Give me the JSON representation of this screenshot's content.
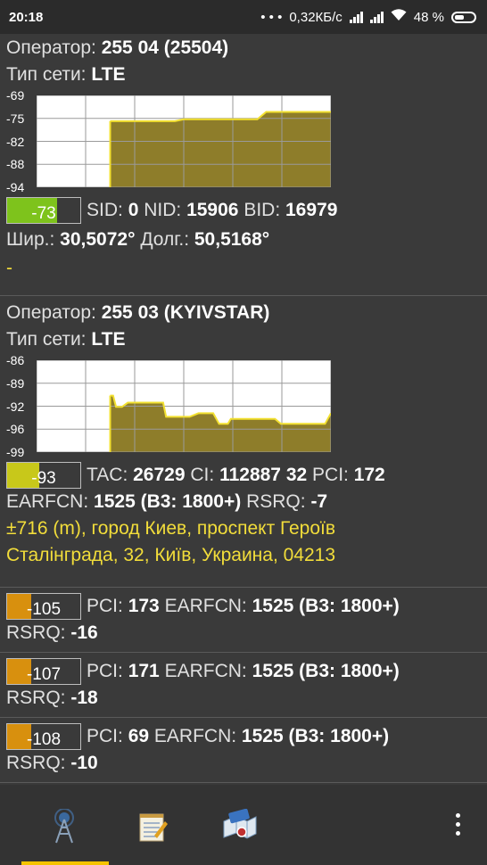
{
  "status_bar": {
    "time": "20:18",
    "dots": "• • •",
    "net_speed": "0,32КБ/с",
    "battery_pct": "48 %"
  },
  "labels": {
    "operator": "Оператор:",
    "network_type": "Тип сети:",
    "sid": "SID:",
    "nid": "NID:",
    "bid": "BID:",
    "lat": "Шир.:",
    "lon": "Долг.:",
    "tac": "TAC:",
    "ci": "CI:",
    "pci": "PCI:",
    "earfcn": "EARFCN:",
    "rsrq": "RSRQ:"
  },
  "cell1": {
    "operator": "255 04 (25504)",
    "network_type": "LTE",
    "signal": "-73",
    "signal_level": 0.68,
    "signal_color": "#7ec31c",
    "sid": "0",
    "nid": "15906",
    "bid": "16979",
    "lat": "30,5072°",
    "lon": "50,5168°",
    "address": "-"
  },
  "cell2": {
    "operator": "255 03 (KYIVSTAR)",
    "network_type": "LTE",
    "signal": "-93",
    "signal_level": 0.44,
    "signal_color": "#c8c81a",
    "tac": "26729",
    "ci": "112887 32",
    "pci": "172",
    "earfcn": "1525 (B3: 1800+)",
    "rsrq": "-7",
    "address_line1": "±716 (m), город Киев, проспект Героїв",
    "address_line2": "Сталінграда, 32, Київ, Украина, 04213"
  },
  "neighbors": [
    {
      "signal": "-105",
      "signal_level": 0.33,
      "pci": "173",
      "earfcn": "1525 (B3: 1800+)",
      "rsrq": "-16"
    },
    {
      "signal": "-107",
      "signal_level": 0.33,
      "pci": "171",
      "earfcn": "1525 (B3: 1800+)",
      "rsrq": "-18"
    },
    {
      "signal": "-108",
      "signal_level": 0.33,
      "pci": "69",
      "earfcn": "1525 (B3: 1800+)",
      "rsrq": "-10"
    }
  ],
  "neighbor_color": "#d8900e",
  "chart_data": [
    {
      "type": "area",
      "yticks": [
        "-69",
        "-75",
        "-82",
        "-88",
        "-94"
      ],
      "ylim": [
        -94,
        -69
      ],
      "x": [
        0.25,
        0.47,
        0.5,
        0.54,
        0.65,
        0.75,
        0.78,
        0.8,
        1.0
      ],
      "y": [
        -76,
        -76,
        -75.5,
        -75.5,
        -75.5,
        -75.5,
        -73.5,
        -73.5,
        -73.5
      ],
      "line_color": "#f2e030",
      "fill_color": "#8e7d2a",
      "grid": true
    },
    {
      "type": "area",
      "yticks": [
        "-86",
        "-89",
        "-92",
        "-96",
        "-99"
      ],
      "ylim": [
        -99,
        -86
      ],
      "x": [
        0.25,
        0.26,
        0.27,
        0.29,
        0.31,
        0.33,
        0.38,
        0.43,
        0.44,
        0.46,
        0.52,
        0.55,
        0.6,
        0.62,
        0.65,
        0.66,
        0.7,
        0.81,
        0.83,
        0.98,
        1.0
      ],
      "y": [
        -91,
        -91,
        -92.6,
        -92.6,
        -92,
        -92,
        -92,
        -92,
        -94,
        -94,
        -94,
        -93.5,
        -93.5,
        -95,
        -95,
        -94.3,
        -94.3,
        -94.3,
        -95,
        -95,
        -93.5
      ],
      "line_color": "#f2e030",
      "fill_color": "#8e7d2a",
      "grid": true
    }
  ]
}
